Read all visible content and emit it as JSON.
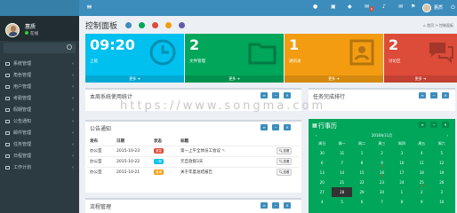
{
  "user": {
    "name": "蕙质",
    "status": "在线"
  },
  "topbar": {
    "username": "蕙质",
    "mail_badge": "6"
  },
  "menu": [
    {
      "label": "系统管理"
    },
    {
      "label": "角色管理"
    },
    {
      "label": "用户管理"
    },
    {
      "label": "考勤管理"
    },
    {
      "label": "假期管理"
    },
    {
      "label": "公告通知"
    },
    {
      "label": "邮件管理"
    },
    {
      "label": "任务管理"
    },
    {
      "label": "日程管理"
    },
    {
      "label": "工作计划"
    }
  ],
  "page": {
    "title": "控制面板",
    "breadcrumb_home": "首页",
    "breadcrumb_current": "控制面板"
  },
  "theme_colors": [
    "#3c8dbc",
    "#00a65a",
    "#dd4b39",
    "#f39c12",
    "#605ca8"
  ],
  "tiles": [
    {
      "value": "09:20",
      "label": "上班",
      "more": "更多",
      "color": "#00c0ef"
    },
    {
      "value": "2",
      "label": "文件管理",
      "more": "更多",
      "color": "#00a65a"
    },
    {
      "value": "1",
      "label": "通讯录",
      "more": "更多",
      "color": "#f39c12"
    },
    {
      "value": "2",
      "label": "讨论区",
      "more": "更多",
      "color": "#dd4b39"
    }
  ],
  "boxes": {
    "usage": "本周系统使用统计",
    "tasks": "任务完成排行",
    "notice": "公告通知",
    "flow": "流程管理"
  },
  "notice_table": {
    "headers": [
      "发布",
      "日期",
      "状态",
      "标题"
    ],
    "rows": [
      {
        "pub": "办公室",
        "date": "2015-10-23",
        "status": "紧急",
        "status_color": "#dd4b39",
        "title": "第一上午全体员工会议",
        "action": "查看"
      },
      {
        "pub": "办公室",
        "date": "2015-10-22",
        "status": "一般",
        "status_color": "#00c0ef",
        "title": "元旦放假3天",
        "action": "查看"
      },
      {
        "pub": "办公室",
        "date": "2015-10-21",
        "status": "普通",
        "status_color": "#f39c12",
        "title": "关于年度总结报告",
        "action": "查看"
      }
    ]
  },
  "calendar": {
    "title": "行事历",
    "month_label": "2016年11月",
    "weekdays": [
      "周日",
      "周一",
      "周二",
      "周三",
      "周四",
      "周五",
      "周六"
    ],
    "weeks": [
      [
        "30",
        "31",
        "1",
        "2",
        "3",
        "4",
        "5"
      ],
      [
        "6",
        "7",
        "8",
        "9",
        "10",
        "11",
        "12"
      ],
      [
        "13",
        "14",
        "15",
        "16",
        "17",
        "18",
        "19"
      ],
      [
        "20",
        "21",
        "22",
        "23",
        "24",
        "25",
        "26"
      ],
      [
        "27",
        "28",
        "29",
        "30",
        "1",
        "2",
        "3"
      ],
      [
        "4",
        "5",
        "6",
        "7",
        "8",
        "9",
        "10"
      ]
    ],
    "today": "28"
  },
  "watermark": "https://www.songma.com"
}
